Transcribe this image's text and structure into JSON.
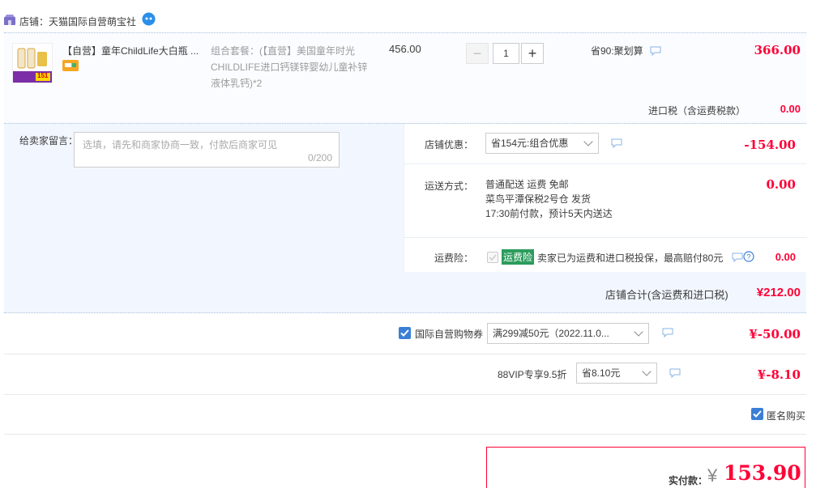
{
  "shop": {
    "name": "店铺：天猫国际自营萌宝社"
  },
  "item": {
    "title": "【自营】童年ChildLife大白瓶 ...",
    "sku": "组合套餐：(【直营】美国童年时光CHILDLIFE进口钙镁锌婴幼儿童补锌液体乳钙)*2",
    "thumb_badge": "151",
    "unit_price": "456.00",
    "quantity": "1",
    "minus_label": "−",
    "plus_label": "+",
    "promo": "省90:聚划算",
    "total": "366.00",
    "tax_label": "进口税（含运费税款）",
    "tax_value": "0.00"
  },
  "message": {
    "label": "给卖家留言：",
    "placeholder": "选填，请先和商家协商一致，付款后商家可见",
    "count": "0/200"
  },
  "shop_discount": {
    "label": "店铺优惠：",
    "selected": "省154元:组合优惠",
    "value": "-154.00"
  },
  "shipping": {
    "label": "运送方式：",
    "line1": "普通配送 运费 免邮",
    "line2": "菜鸟平潭保税2号仓  发货",
    "line3": "17:30前付款，预计5天内送达",
    "value": "0.00"
  },
  "insurance": {
    "label": "运费险：",
    "tag": "运费险",
    "text": "卖家已为运费和进口税投保，最高赔付80元",
    "value": "0.00"
  },
  "shop_total": {
    "label": "店铺合计(含运费和进口税)",
    "value": "¥212.00"
  },
  "coupon": {
    "label": "国际自营购物券",
    "selected": "满299减50元（2022.11.0...",
    "value": "¥-50.00"
  },
  "vip": {
    "label": "88VIP专享9.5折",
    "selected": "省8.10元",
    "value": "¥-8.10"
  },
  "anonymous": {
    "label": "匿名购买"
  },
  "payment": {
    "label": "实付款：",
    "currency": "¥",
    "amount": "153.90"
  },
  "colors": {
    "accent_red": "#ff0036",
    "checkbox_blue": "#3a7fd5",
    "insurance_green": "#2c9c5c",
    "panel_blue": "#f2f7ff"
  }
}
